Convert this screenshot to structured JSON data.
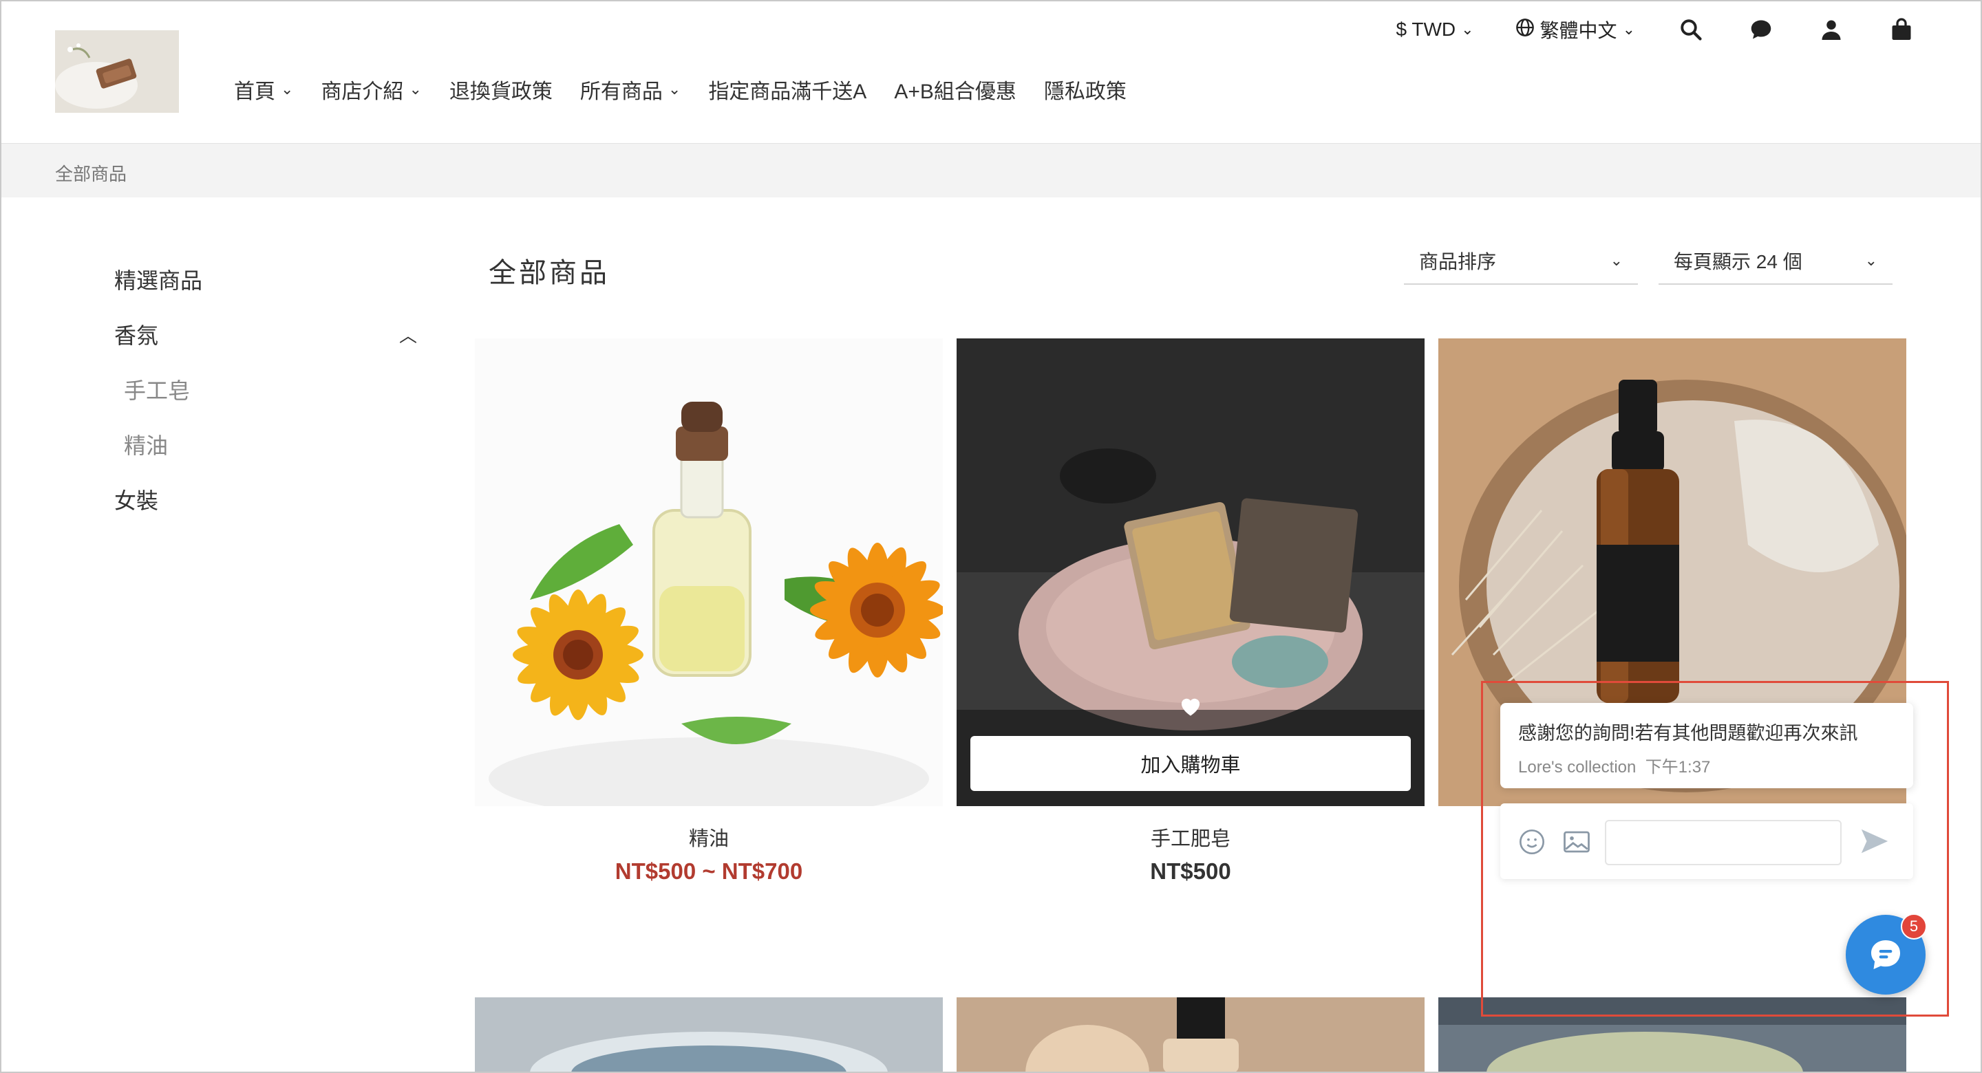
{
  "header": {
    "logo_alt": "Lore's collection logo",
    "nav": [
      {
        "label": "首頁",
        "has_dropdown": true
      },
      {
        "label": "商店介紹",
        "has_dropdown": true
      },
      {
        "label": "退換貨政策",
        "has_dropdown": false
      },
      {
        "label": "所有商品",
        "has_dropdown": true
      },
      {
        "label": "指定商品滿千送A",
        "has_dropdown": false
      },
      {
        "label": "A+B組合優惠",
        "has_dropdown": false
      },
      {
        "label": "隱私政策",
        "has_dropdown": false
      }
    ],
    "currency": "$ TWD",
    "language": "繁體中文",
    "icons": [
      "search-icon",
      "chat-icon",
      "user-icon",
      "cart-icon"
    ]
  },
  "breadcrumb": "全部商品",
  "sidebar": {
    "categories": [
      {
        "label": "精選商品",
        "level": 0
      },
      {
        "label": "香氛",
        "level": 0,
        "expanded": true
      },
      {
        "label": "手工皂",
        "level": 1
      },
      {
        "label": "精油",
        "level": 1
      },
      {
        "label": "女裝",
        "level": 0
      }
    ]
  },
  "main": {
    "title": "全部商品",
    "sort_label": "商品排序",
    "per_page_label": "每頁顯示 24 個",
    "products": [
      {
        "name": "精油",
        "price": "NT$500 ~ NT$700",
        "price_highlight": true
      },
      {
        "name": "手工肥皂",
        "price": "NT$500",
        "price_highlight": false,
        "add_to_cart": "加入購物車"
      },
      {
        "name": "",
        "price": "",
        "price_highlight": false
      }
    ]
  },
  "chat": {
    "message": "感謝您的詢問!若有其他問題歡迎再次來訊",
    "sender": "Lore's collection",
    "time": "下午1:37",
    "unread_count": "5"
  },
  "colors": {
    "accent_price": "#b23b2f",
    "chat_fab": "#2f8ae0",
    "highlight_box": "#e04b3a"
  }
}
